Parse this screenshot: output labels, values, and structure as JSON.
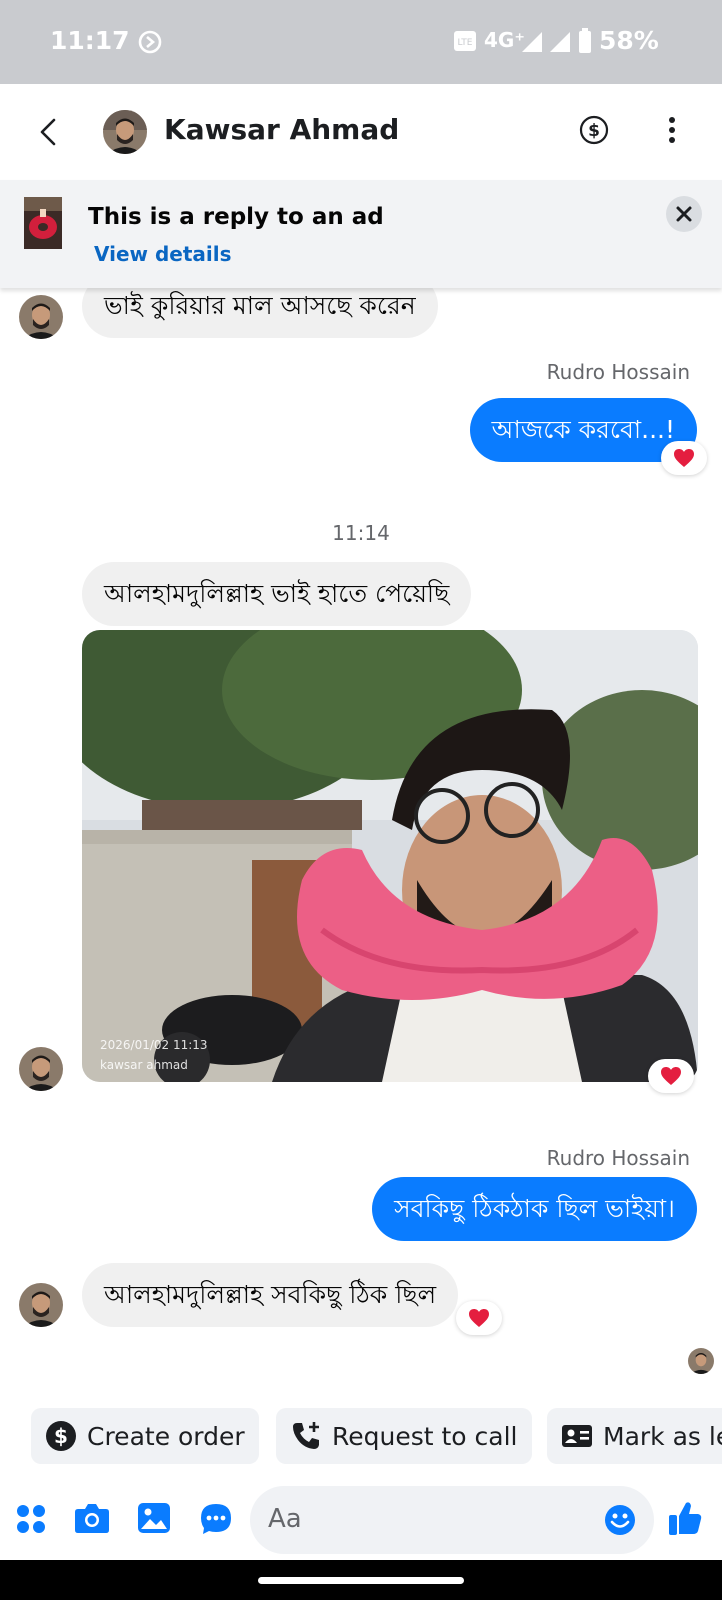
{
  "status_bar": {
    "time": "11:17",
    "network": "4G⁺",
    "battery": "58%"
  },
  "header": {
    "contact_name": "Kawsar Ahmad"
  },
  "ad_banner": {
    "title": "This is a reply to an ad",
    "link": "View details"
  },
  "messages": {
    "m1": "ভাই কুরিয়ার মাল আসছে করেন",
    "sender_1": "Rudro Hossain",
    "m2": "আজকে করবো...!",
    "timestamp": "11:14",
    "m3": "আলহামদুলিল্লাহ ভাই হাতে পেয়েছি",
    "photo_stamp_date": "2026/01/02 11:13",
    "photo_stamp_name": "kawsar ahmad",
    "sender_2": "Rudro Hossain",
    "m4": "সবকিছু ঠিকঠাক ছিল ভাইয়া।",
    "m5": "আলহামদুলিল্লাহ সবকিছু ঠিক ছিল"
  },
  "quick_actions": {
    "create_order": "Create order",
    "request_call": "Request to call",
    "mark_as": "Mark as le"
  },
  "composer": {
    "placeholder": "Aa"
  },
  "colors": {
    "accent": "#0a7cff",
    "link": "#0a66c2",
    "heart": "#e41e3f"
  }
}
